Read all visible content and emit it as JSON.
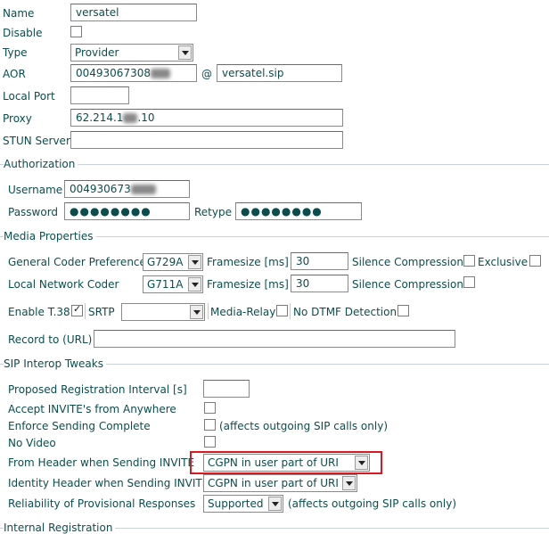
{
  "general": {
    "name_label": "Name",
    "name_value": "versatel",
    "disable_label": "Disable",
    "disable_checked": false,
    "type_label": "Type",
    "type_value": "Provider",
    "aor_label": "AOR",
    "aor_user_value": "00493067308",
    "aor_user_tail": "",
    "aor_at": "@",
    "aor_domain_value": "versatel.sip",
    "local_port_label": "Local Port",
    "local_port_value": "",
    "proxy_label": "Proxy",
    "proxy_value": "62.214.1",
    "proxy_tail": ".10",
    "stun_label": "STUN Server",
    "stun_value": ""
  },
  "authorization": {
    "section_title": "Authorization",
    "username_label": "Username",
    "username_value": "004930673",
    "username_tail": "",
    "password_label": "Password",
    "password_value": "●●●●●●●●",
    "retype_label": "Retype",
    "retype_value": "●●●●●●●●"
  },
  "media": {
    "section_title": "Media Properties",
    "general_coder_label": "General Coder Preference",
    "general_coder_value": "G729A",
    "framesize_label_1": "Framesize [ms]",
    "framesize_value_1": "30",
    "silence_label_1": "Silence Compression",
    "silence_checked_1": false,
    "exclusive_label": "Exclusive",
    "exclusive_checked": false,
    "local_coder_label": "Local Network Coder",
    "local_coder_value": "G711A",
    "framesize_label_2": "Framesize [ms]",
    "framesize_value_2": "30",
    "silence_label_2": "Silence Compression",
    "silence_checked_2": false,
    "t38_label": "Enable T.38",
    "t38_checked": true,
    "srtp_label": "SRTP",
    "srtp_value": "",
    "media_relay_label": "Media-Relay",
    "media_relay_checked": false,
    "no_dtmf_label": "No DTMF Detection",
    "no_dtmf_checked": false,
    "record_label": "Record to (URL)",
    "record_value": ""
  },
  "sip": {
    "section_title": "SIP Interop Tweaks",
    "reg_interval_label": "Proposed Registration Interval [s]",
    "reg_interval_value": "",
    "accept_invite_label": "Accept INVITE's from Anywhere",
    "accept_invite_checked": false,
    "enforce_label": "Enforce Sending Complete",
    "enforce_checked": false,
    "enforce_note": "(affects outgoing SIP calls only)",
    "no_video_label": "No Video",
    "no_video_checked": false,
    "from_header_label": "From Header when Sending INVITE",
    "from_header_value": "CGPN in user part of URI",
    "identity_header_label": "Identity Header when Sending INVITE",
    "identity_header_value": "CGPN in user part of URI",
    "reliability_label": "Reliability of Provisional Responses",
    "reliability_value": "Supported",
    "reliability_note": "(affects outgoing SIP calls only)"
  },
  "internal": {
    "section_title": "Internal Registration"
  },
  "colors": {
    "label_text": "#0b4d4d",
    "highlight": "#d9181f",
    "section_line": "#c8d3d3"
  }
}
